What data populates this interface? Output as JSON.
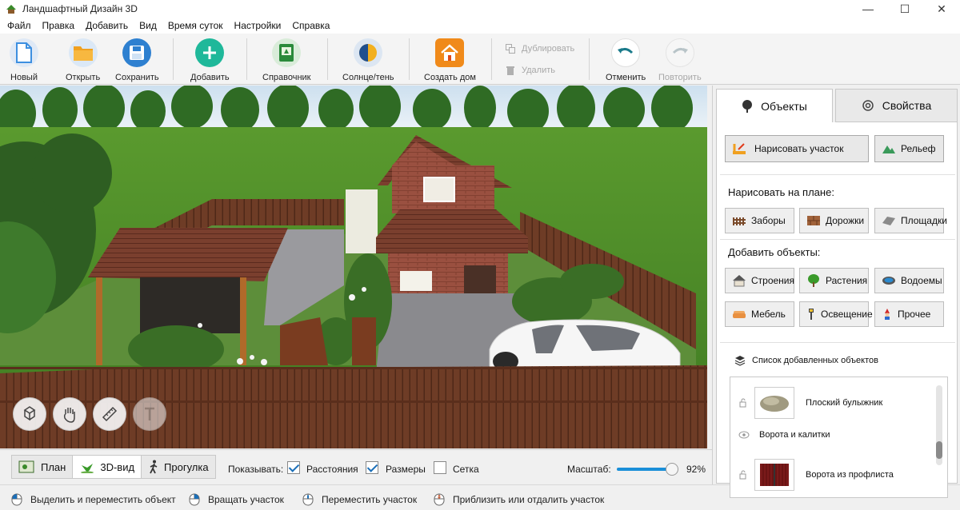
{
  "window": {
    "title": "Ландшафтный Дизайн 3D"
  },
  "menu": [
    "Файл",
    "Правка",
    "Добавить",
    "Вид",
    "Время суток",
    "Настройки",
    "Справка"
  ],
  "toolbar": {
    "new": "Новый",
    "open": "Открыть",
    "save": "Сохранить",
    "add": "Добавить",
    "reference": "Справочник",
    "sun_shadow": "Солнце/тень",
    "create_house": "Создать дом",
    "duplicate": "Дублировать",
    "delete": "Удалить",
    "undo": "Отменить",
    "redo": "Повторить"
  },
  "view_modes": {
    "plan": "План",
    "view3d": "3D-вид",
    "walk": "Прогулка",
    "active": "3D-вид"
  },
  "display": {
    "label": "Показывать:",
    "distances": "Расстояния",
    "distances_checked": true,
    "sizes": "Размеры",
    "sizes_checked": true,
    "grid": "Сетка",
    "grid_checked": false
  },
  "zoom": {
    "label": "Масштаб:",
    "value": "92%",
    "level": 0.82
  },
  "status": {
    "select": "Выделить и переместить объект",
    "rotate": "Вращать участок",
    "move": "Переместить участок",
    "zoom": "Приблизить или отдалить участок"
  },
  "panel": {
    "tabs": {
      "objects": "Объекты",
      "properties": "Свойства",
      "active": "Объекты"
    },
    "draw_plot": "Нарисовать участок",
    "relief": "Рельеф",
    "draw_on_plan_title": "Нарисовать на плане:",
    "fences": "Заборы",
    "paths": "Дорожки",
    "platforms": "Площадки",
    "add_objects_title": "Добавить объекты:",
    "buildings": "Строения",
    "plants": "Растения",
    "ponds": "Водоемы",
    "furniture": "Мебель",
    "lighting": "Освещение",
    "other": "Прочее",
    "list_title": "Список добавленных объектов",
    "list_items": [
      {
        "name": "Плоский булыжник"
      },
      {
        "name": "Ворота и калитки"
      },
      {
        "name": "Ворота из профлиста"
      }
    ]
  },
  "colors": {
    "new_icon": "#3d8fe0",
    "open_icon": "#f0a020",
    "save_icon": "#2e80d0",
    "add_icon": "#1fb89a",
    "reference_icon": "#2a8a3a",
    "create_house_icon": "#f08a1a",
    "fence": "#6a3a24",
    "grass": "#4f8c2a"
  }
}
